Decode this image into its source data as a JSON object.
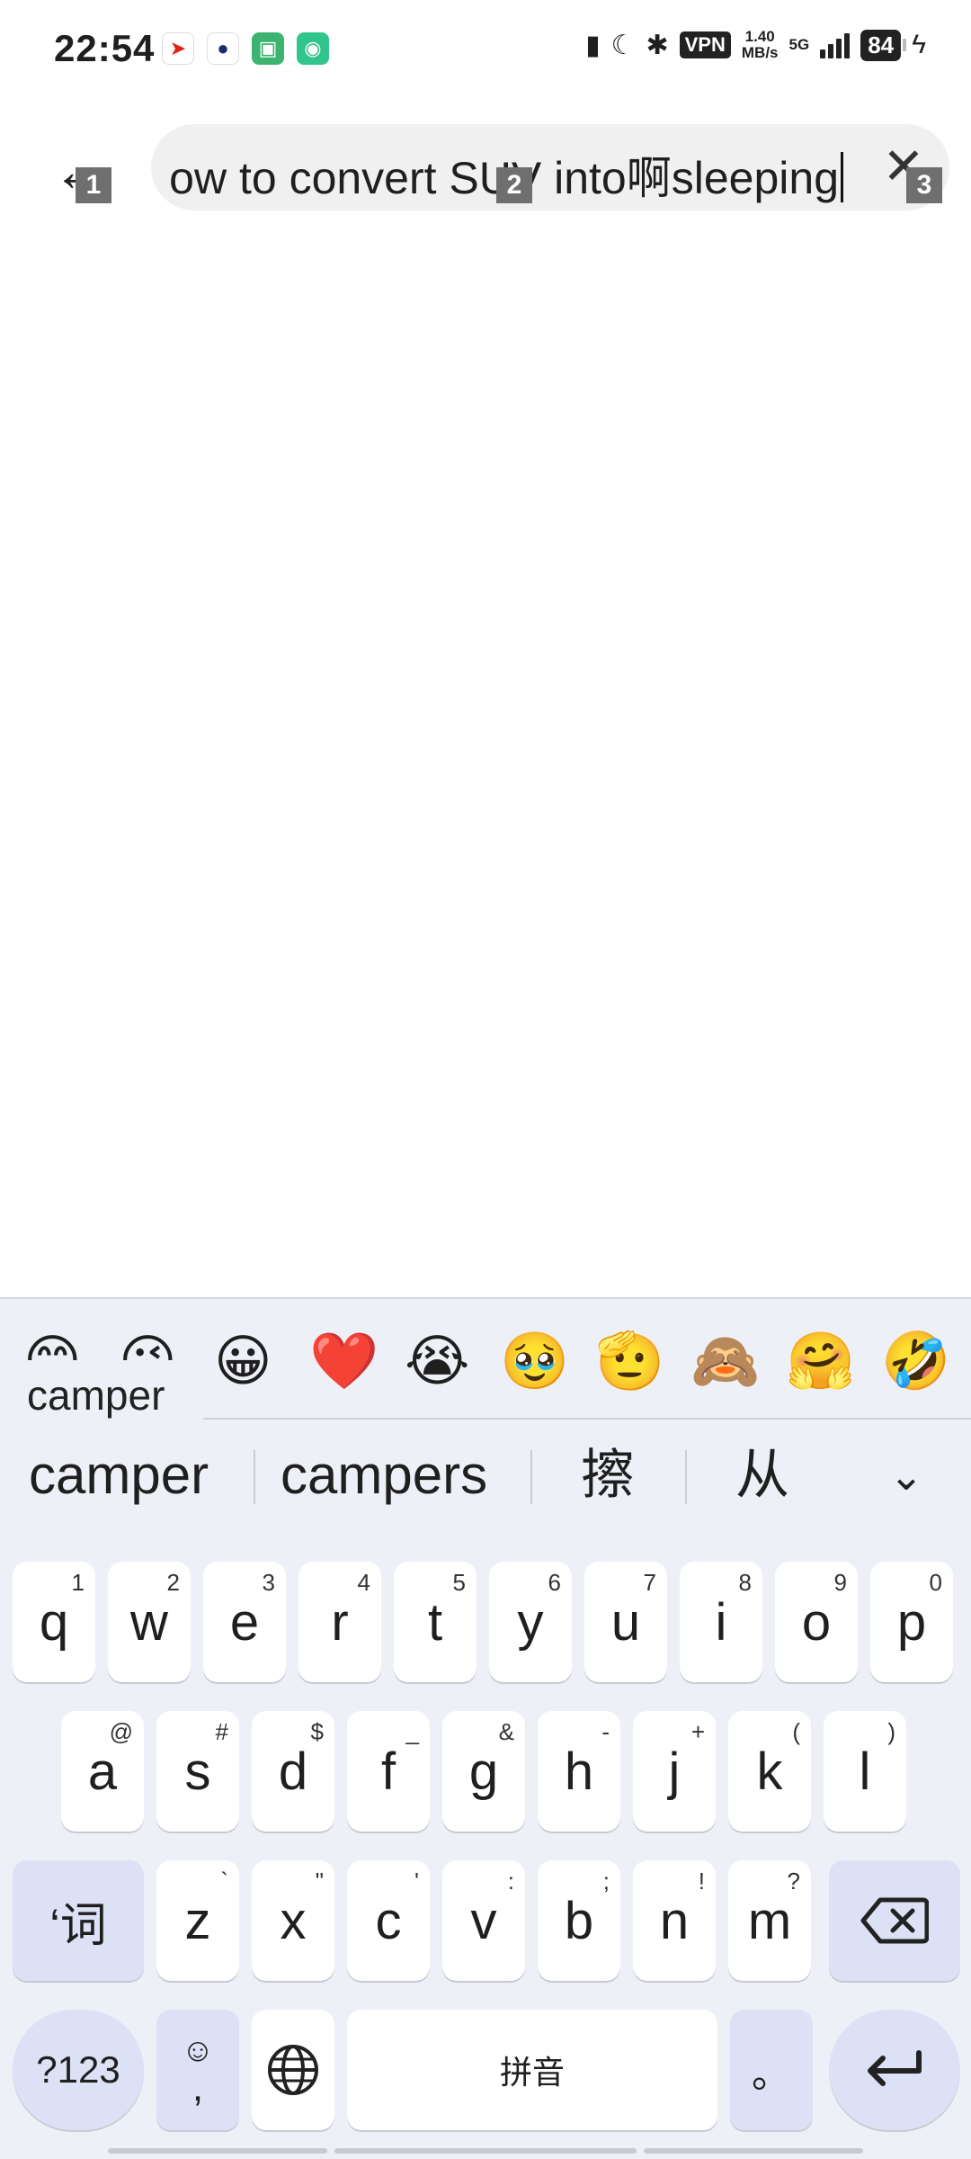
{
  "status_bar": {
    "time": "22:54",
    "vpn": "VPN",
    "speed_value": "1.40",
    "speed_unit": "MB/s",
    "network": "5G",
    "battery": "84"
  },
  "search": {
    "query": "ow to convert SUV into啊sleeping",
    "back_badge": "1",
    "field_badge": "2",
    "clear_badge": "3"
  },
  "keyboard": {
    "emojis": [
      "😊",
      "😘",
      "😀",
      "❤️",
      "😭",
      "🥹",
      "🫡",
      "🙈",
      "🤗",
      "🤣"
    ],
    "suggestion_popup": "camper",
    "candidates": [
      "camper",
      "campers",
      "擦",
      "从"
    ],
    "row1": [
      {
        "key": "q",
        "hint": "1"
      },
      {
        "key": "w",
        "hint": "2"
      },
      {
        "key": "e",
        "hint": "3"
      },
      {
        "key": "r",
        "hint": "4"
      },
      {
        "key": "t",
        "hint": "5"
      },
      {
        "key": "y",
        "hint": "6"
      },
      {
        "key": "u",
        "hint": "7"
      },
      {
        "key": "i",
        "hint": "8"
      },
      {
        "key": "o",
        "hint": "9"
      },
      {
        "key": "p",
        "hint": "0"
      }
    ],
    "row2": [
      {
        "key": "a",
        "hint": "@"
      },
      {
        "key": "s",
        "hint": "#"
      },
      {
        "key": "d",
        "hint": "$"
      },
      {
        "key": "f",
        "hint": "_"
      },
      {
        "key": "g",
        "hint": "&"
      },
      {
        "key": "h",
        "hint": "-"
      },
      {
        "key": "j",
        "hint": "+"
      },
      {
        "key": "k",
        "hint": "("
      },
      {
        "key": "l",
        "hint": ")"
      }
    ],
    "row3": [
      {
        "key": "z",
        "hint": "`"
      },
      {
        "key": "x",
        "hint": "\""
      },
      {
        "key": "c",
        "hint": "'"
      },
      {
        "key": "v",
        "hint": ":"
      },
      {
        "key": "b",
        "hint": ";"
      },
      {
        "key": "n",
        "hint": "!"
      },
      {
        "key": "m",
        "hint": "?"
      }
    ],
    "ci_key": "‘词",
    "sym_key": "?123",
    "emoji_comma_top": "☺",
    "emoji_comma_bottom": ",",
    "space_key": "拼音",
    "period_key": "。"
  }
}
